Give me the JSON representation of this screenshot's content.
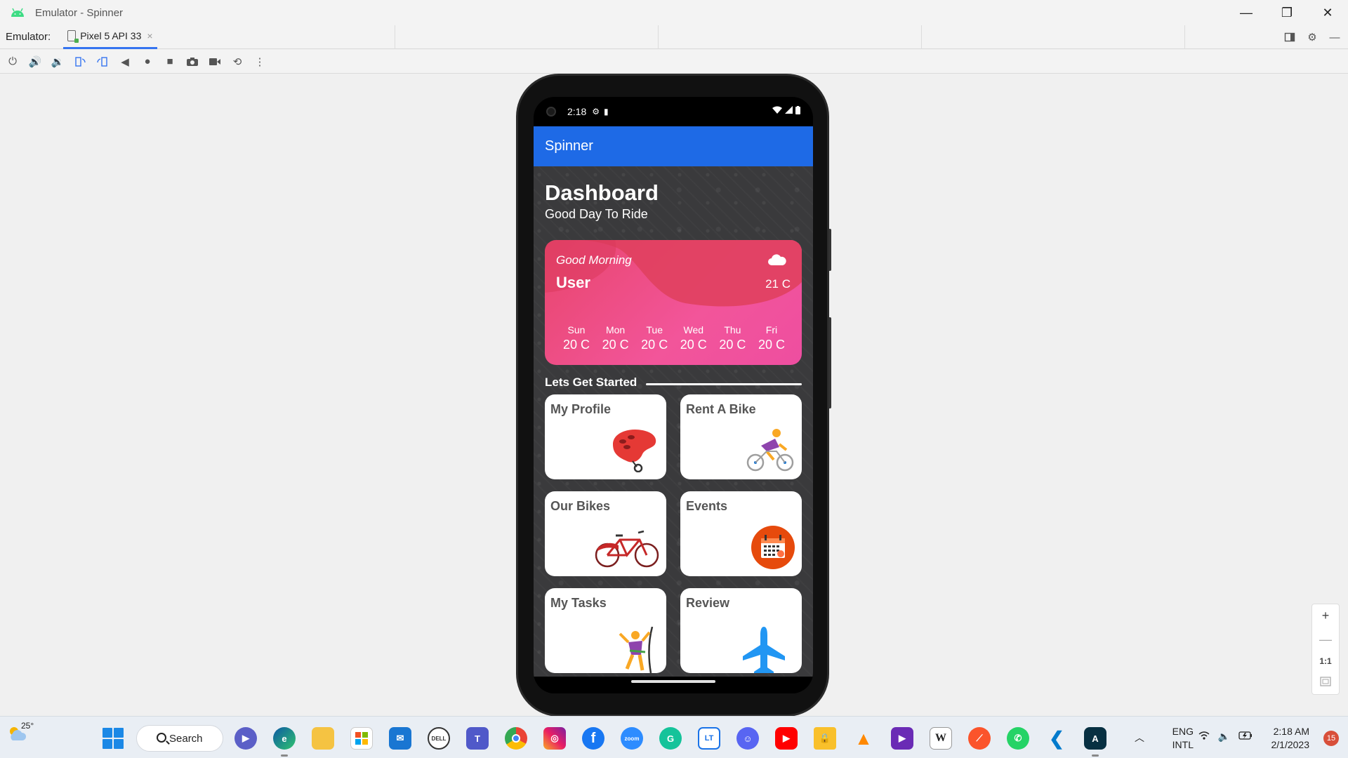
{
  "window": {
    "title": "Emulator - Spinner",
    "controls": {
      "minimize": "—",
      "restore": "❐",
      "close": "✕"
    }
  },
  "emulator_bar": {
    "label": "Emulator:",
    "tab": "Pixel 5 API 33",
    "tab_close": "×"
  },
  "toolbar": {
    "items": [
      "power-icon",
      "volume-up-icon",
      "volume-down-icon",
      "rotate-left-icon",
      "rotate-right-icon",
      "back-icon",
      "home-icon",
      "overview-icon",
      "screenshot-icon",
      "screenrecord-icon",
      "snapshot-icon",
      "more-icon"
    ]
  },
  "zoom": {
    "plus": "+",
    "minus": "—",
    "one_to_one": "1:1"
  },
  "phone": {
    "status": {
      "time": "2:18"
    },
    "app_title": "Spinner",
    "dashboard": {
      "title": "Dashboard",
      "subtitle": "Good Day To Ride"
    },
    "weather": {
      "greeting": "Good Morning",
      "user": "User",
      "temp": "21 C",
      "days": [
        {
          "name": "Sun",
          "temp": "20 C"
        },
        {
          "name": "Mon",
          "temp": "20 C"
        },
        {
          "name": "Tue",
          "temp": "20 C"
        },
        {
          "name": "Wed",
          "temp": "20 C"
        },
        {
          "name": "Thu",
          "temp": "20 C"
        },
        {
          "name": "Fri",
          "temp": "20 C"
        }
      ]
    },
    "section_title": "Lets Get Started",
    "cards": [
      {
        "label": "My Profile",
        "icon": "helmet-icon"
      },
      {
        "label": "Rent A Bike",
        "icon": "cyclist-icon"
      },
      {
        "label": "Our Bikes",
        "icon": "bicycle-icon"
      },
      {
        "label": "Events",
        "icon": "calendar-icon"
      },
      {
        "label": "My Tasks",
        "icon": "climber-icon"
      },
      {
        "label": "Review",
        "icon": "airplane-icon"
      }
    ],
    "colors": {
      "app_bar": "#1e6ae6",
      "card_gradient_start": "#e8456b",
      "card_gradient_end": "#ee4ea0"
    }
  },
  "taskbar": {
    "weather_temp": "25°",
    "search_label": "Search",
    "apps": [
      "chat-icon",
      "edge-icon",
      "file-explorer-icon",
      "store-icon",
      "mail-icon",
      "dell-icon",
      "teams-icon",
      "chrome-icon",
      "instagram-icon",
      "facebook-icon",
      "zoom-icon",
      "grammarly-icon",
      "tt-icon",
      "discord-icon",
      "youtube-icon",
      "vpn-icon",
      "vlc-icon",
      "visual-studio-icon",
      "wikipedia-icon",
      "brave-icon",
      "whatsapp-icon",
      "vscode-icon",
      "android-studio-icon"
    ],
    "app_texts": {
      "dell": "DELL",
      "zoom": "zoom",
      "tt": "LT",
      "wiki": "W"
    },
    "language": {
      "line1": "ENG",
      "line2": "INTL"
    },
    "clock": {
      "time": "2:18 AM",
      "date": "2/1/2023"
    },
    "notifications": "15"
  }
}
